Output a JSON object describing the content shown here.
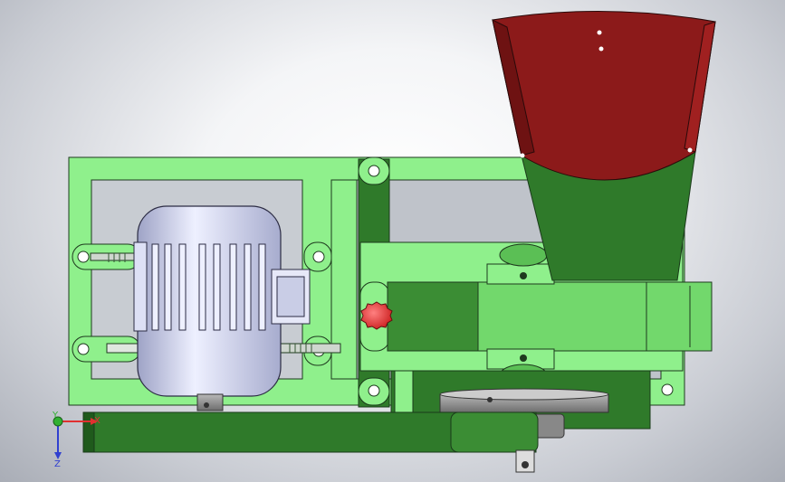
{
  "viewport": {
    "background": "gradient-grey",
    "colors": {
      "frame_green": "#8ff08c",
      "dark_green": "#2f7a2a",
      "hopper_red": "#8c1a1a",
      "motor_silver": "#c9cde6",
      "knob_red": "#f04848"
    }
  },
  "triad": {
    "x_label": "X",
    "y_label": "Y",
    "z_label": "Z",
    "x_color": "#e03030",
    "y_color": "#30b030",
    "z_color": "#3040d0"
  },
  "parts": [
    {
      "name": "base-frame",
      "icon": "frame"
    },
    {
      "name": "electric-motor",
      "icon": "motor"
    },
    {
      "name": "hopper",
      "icon": "funnel"
    },
    {
      "name": "adjust-knob",
      "icon": "knob"
    },
    {
      "name": "pulley",
      "icon": "pulley"
    },
    {
      "name": "bottom-rail",
      "icon": "rail"
    }
  ]
}
